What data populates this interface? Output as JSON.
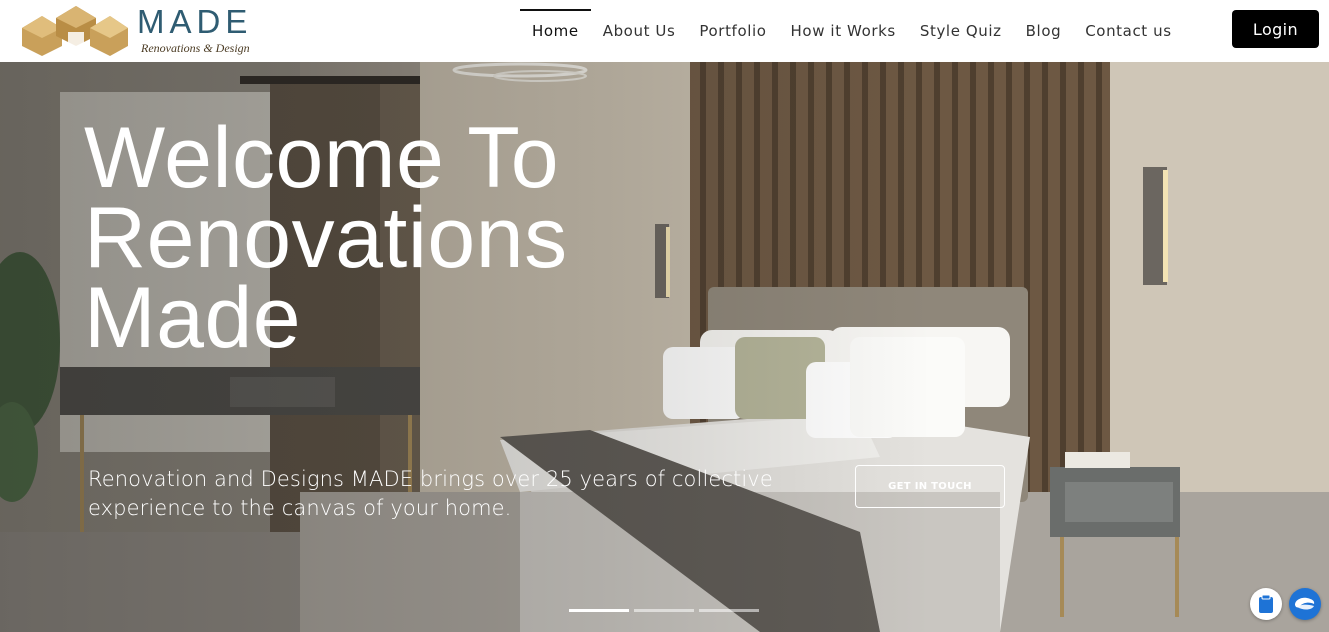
{
  "brand": {
    "name": "MADE",
    "tagline": "Renovations & Design",
    "colors": {
      "gold": "#c9a05a",
      "navy": "#2f5c72"
    }
  },
  "nav": {
    "items": [
      {
        "label": "Home",
        "active": true
      },
      {
        "label": "About Us",
        "active": false
      },
      {
        "label": "Portfolio",
        "active": false
      },
      {
        "label": "How it Works",
        "active": false
      },
      {
        "label": "Style Quiz",
        "active": false
      },
      {
        "label": "Blog",
        "active": false
      },
      {
        "label": "Contact us",
        "active": false
      }
    ],
    "login_label": "Login"
  },
  "hero": {
    "title_lines": [
      "Welcome To",
      "Renovations",
      "Made"
    ],
    "subtitle": "Renovation and Designs MADE brings over 25 years of collective experience to the canvas of your home.",
    "cta_label": "GET IN TOUCH",
    "slides": {
      "count": 3,
      "active_index": 0
    }
  },
  "floating": {
    "left_icon": "clipboard-icon",
    "right_icon": "chat-icon",
    "right_color": "#1e73d6"
  }
}
